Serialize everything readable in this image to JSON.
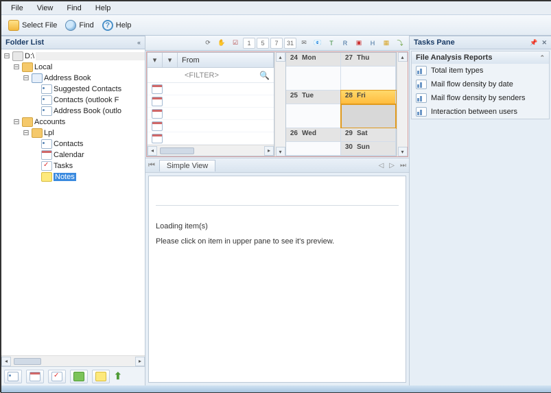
{
  "menu": {
    "file": "File",
    "view": "View",
    "find": "Find",
    "help": "Help"
  },
  "toolbar": {
    "select_file": "Select File",
    "find": "Find",
    "help": "Help"
  },
  "folder_pane": {
    "title": "Folder List"
  },
  "tree": {
    "root": "D:\\",
    "local": "Local",
    "address_book": "Address Book",
    "suggested": "Suggested Contacts",
    "contacts_outlook": "Contacts (outlook F",
    "ab_outlook": "Address Book (outlo",
    "accounts": "Accounts",
    "lpl": "Lpl",
    "contacts": "Contacts",
    "calendar": "Calendar",
    "tasks": "Tasks",
    "notes": "Notes"
  },
  "list": {
    "from_header": "From",
    "filter_placeholder": "<FILTER>"
  },
  "calendar": {
    "cells": [
      {
        "d": "24",
        "n": "Mon"
      },
      {
        "d": "27",
        "n": "Thu"
      },
      {
        "d": "25",
        "n": "Tue"
      },
      {
        "d": "28",
        "n": "Fri"
      },
      {
        "d": "26",
        "n": "Wed"
      },
      {
        "d": "29",
        "n": "Sat"
      },
      {
        "d": "",
        "n": ""
      },
      {
        "d": "30",
        "n": "Sun"
      }
    ]
  },
  "tabs": {
    "simple": "Simple View"
  },
  "preview": {
    "loading": "Loading item(s)",
    "hint": "Please click on item in upper pane to see it's preview."
  },
  "tasks_pane": {
    "title": "Tasks Pane"
  },
  "reports": {
    "title": "File Analysis Reports",
    "items": [
      "Total item types",
      "Mail flow density by date",
      "Mail flow density by senders",
      "Interaction between users"
    ]
  }
}
